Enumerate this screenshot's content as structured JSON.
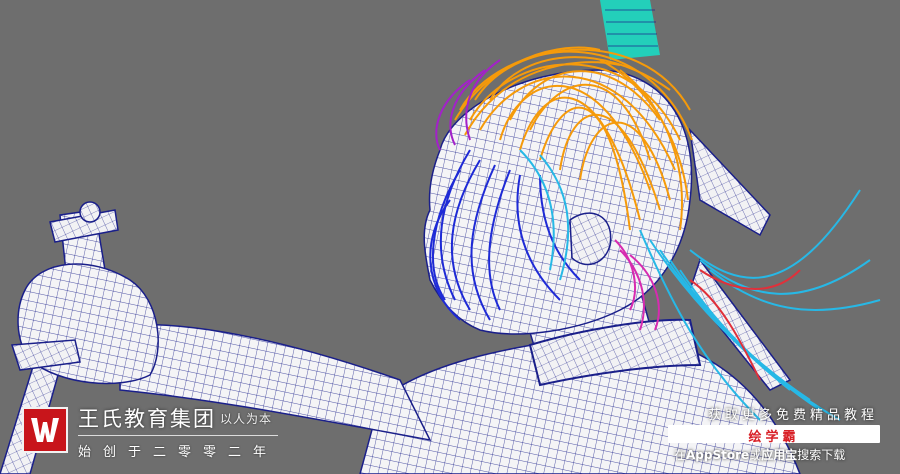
{
  "scene": {
    "background": "#6e6e6e",
    "mesh_color": "#1a1f8a",
    "skin_color": "#f4f4f6",
    "hair_colors": [
      "#f59a0a",
      "#1e2ad6",
      "#27b8e6",
      "#a321c9",
      "#d72bb0",
      "#e0303a",
      "#16e0c8"
    ]
  },
  "watermark": {
    "brand_name": "王氏教育集团",
    "slogan": "以人为本",
    "founded": "始创于二零零二年",
    "logo_color": "#c8151b"
  },
  "promo": {
    "top_text": "获取更多免费精品教程",
    "app_name": "绘学霸",
    "bottom_prefix": "在",
    "bottom_appstore": "AppStore",
    "bottom_or": "或",
    "bottom_yyb": "应用宝",
    "bottom_suffix": "搜索下载",
    "app_color": "#d81f26"
  }
}
